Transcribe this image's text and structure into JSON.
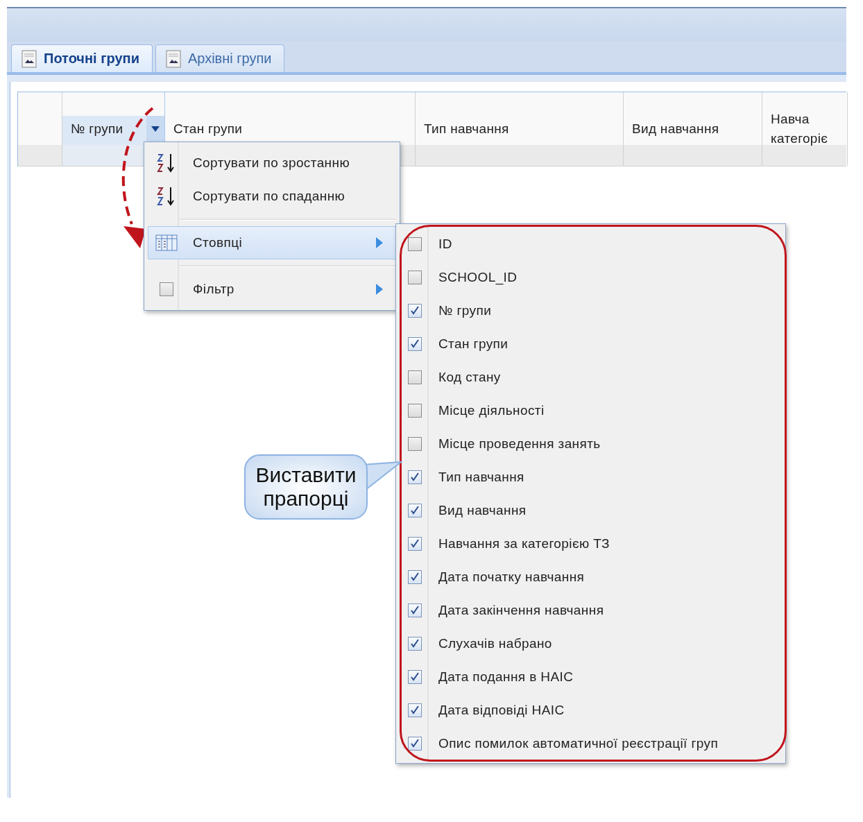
{
  "tabs": [
    {
      "label": "Поточні групи",
      "selected": true
    },
    {
      "label": "Архівні групи",
      "selected": false
    }
  ],
  "grid": {
    "columns": [
      {
        "label": "№ групи",
        "selected": true
      },
      {
        "label": "Стан групи",
        "selected": false
      },
      {
        "label": "Тип навчання",
        "selected": false
      },
      {
        "label": "Вид навчання",
        "selected": false
      },
      {
        "label": "Навча\nкатегоріє",
        "selected": false
      }
    ]
  },
  "column_menu": {
    "items": [
      {
        "kind": "sort_ascending",
        "label": "Сортувати по зростанню",
        "selected": false,
        "has_submenu": false
      },
      {
        "kind": "sort_descending",
        "label": "Сортувати по спаданню",
        "selected": false,
        "has_submenu": false
      },
      {
        "kind": "separator"
      },
      {
        "kind": "columns",
        "label": "Стовпці",
        "selected": true,
        "has_submenu": true
      },
      {
        "kind": "separator"
      },
      {
        "kind": "checkbox",
        "label": "Фільтр",
        "checked": false,
        "selected": false,
        "has_submenu": true
      }
    ]
  },
  "columns_submenu": {
    "items": [
      {
        "label": "ID",
        "checked": false
      },
      {
        "label": "SCHOOL_ID",
        "checked": false
      },
      {
        "label": "№ групи",
        "checked": true
      },
      {
        "label": "Стан групи",
        "checked": true
      },
      {
        "label": "Код стану",
        "checked": false
      },
      {
        "label": "Місце діяльності",
        "checked": false
      },
      {
        "label": "Місце проведення занять",
        "checked": false
      },
      {
        "label": "Тип навчання",
        "checked": true
      },
      {
        "label": "Вид навчання",
        "checked": true
      },
      {
        "label": "Навчання за категорією ТЗ",
        "checked": true
      },
      {
        "label": "Дата початку навчання",
        "checked": true
      },
      {
        "label": "Дата закінчення навчання",
        "checked": true
      },
      {
        "label": "Слухачів набрано",
        "checked": true
      },
      {
        "label": "Дата подання в НАІС",
        "checked": true
      },
      {
        "label": "Дата відповіді НАІС",
        "checked": true
      },
      {
        "label": "Опис помилок автоматичної реєстрації груп",
        "checked": true
      }
    ]
  },
  "callout": {
    "text": "Виставити прапорці"
  }
}
